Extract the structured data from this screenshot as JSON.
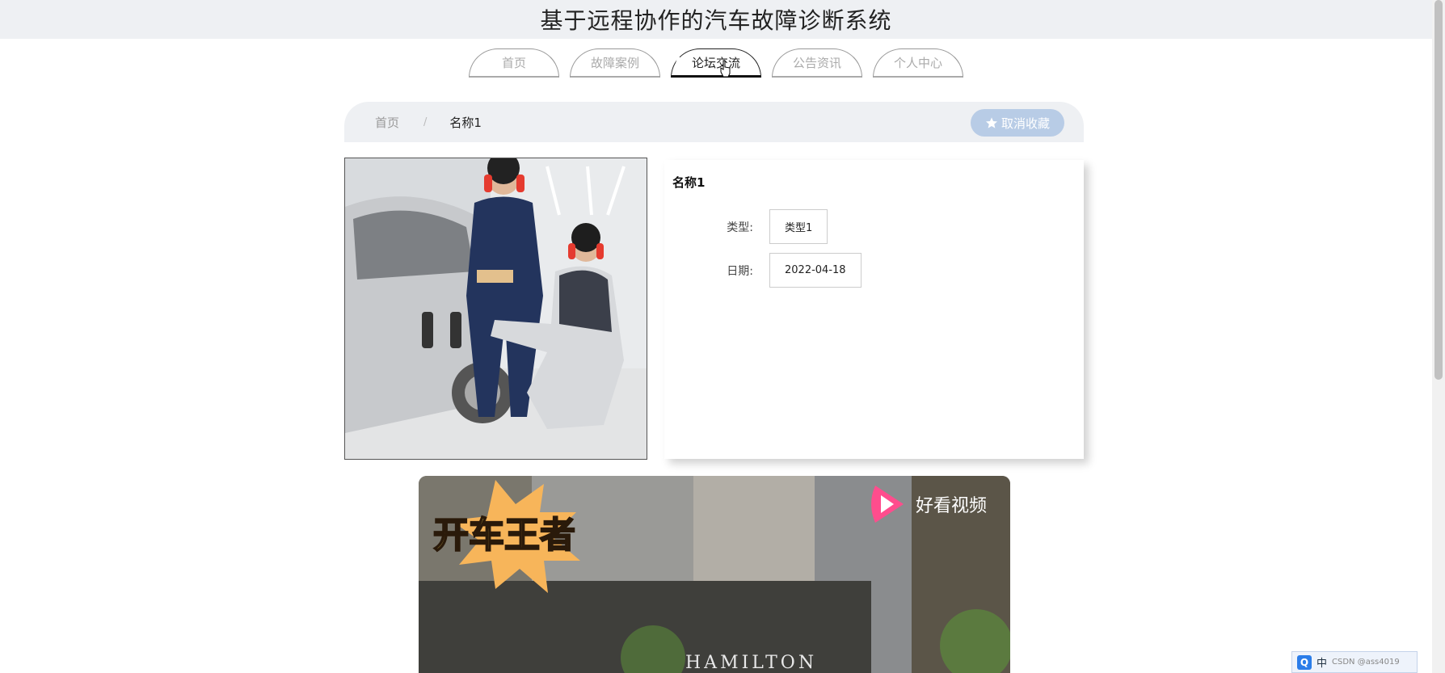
{
  "app": {
    "title": "基于远程协作的汽车故障诊断系统"
  },
  "nav": {
    "tabs": [
      {
        "label": "首页",
        "active": false
      },
      {
        "label": "故障案例",
        "active": false
      },
      {
        "label": "论坛交流",
        "active": true
      },
      {
        "label": "公告资讯",
        "active": false
      },
      {
        "label": "个人中心",
        "active": false
      }
    ]
  },
  "breadcrumb": {
    "home": "首页",
    "separator": "/",
    "current": "名称1"
  },
  "actions": {
    "unfavorite_label": "取消收藏",
    "unfavorite_icon": "star-icon"
  },
  "detail": {
    "name": "名称1",
    "fields": [
      {
        "label": "类型:",
        "value": "类型1"
      },
      {
        "label": "日期:",
        "value": "2022-04-18"
      }
    ]
  },
  "video": {
    "overlay_title": "开车王者",
    "platform": "好看视频",
    "sign_text": "HAMILTON"
  },
  "taskbar": {
    "ime_logo": "Q",
    "ime_mode": "中",
    "watermark": "CSDN @ass4019"
  },
  "colors": {
    "button_bg": "#b8cce6",
    "header_bg": "#eef0f3",
    "ime_blue": "#2b7de9"
  }
}
